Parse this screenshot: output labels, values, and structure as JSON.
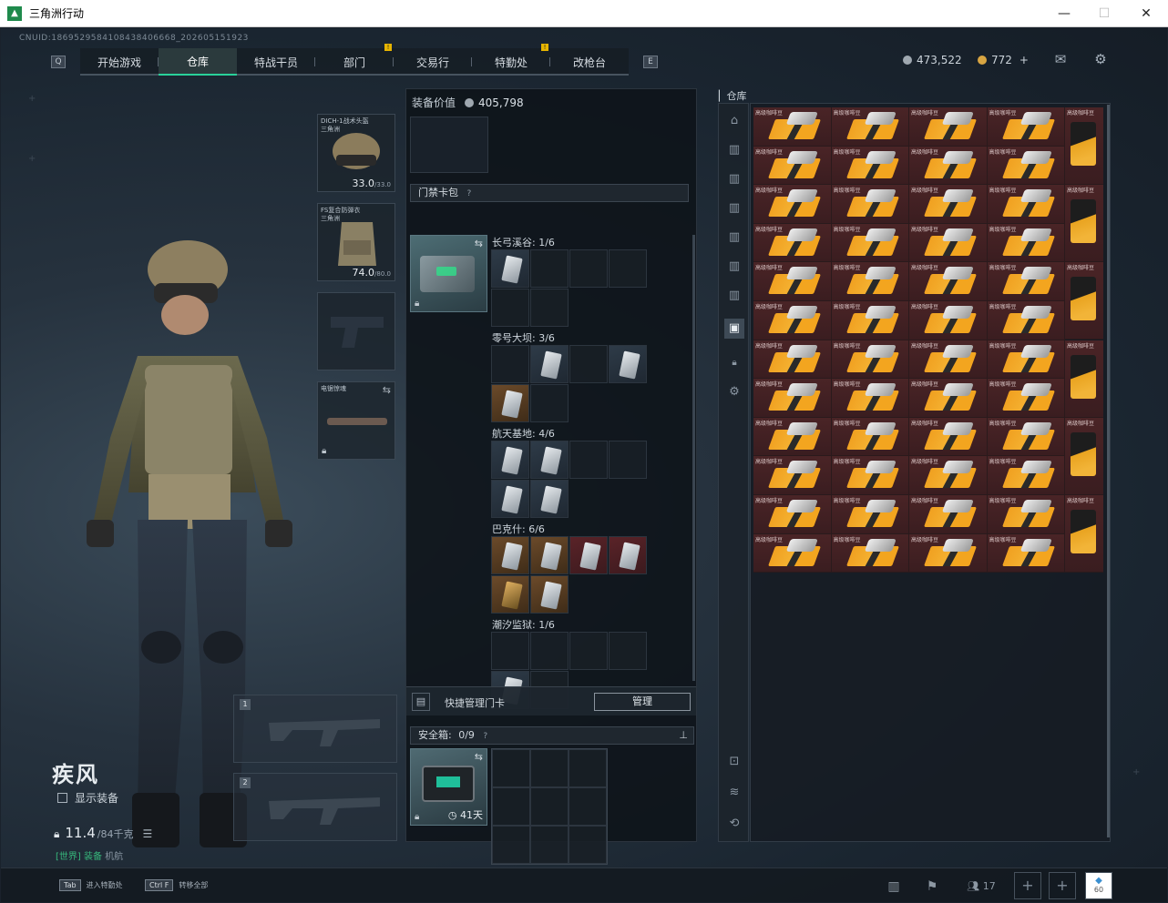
{
  "window": {
    "title": "三角洲行动"
  },
  "uid": "CNUID:1869529584108438406668_202605151923",
  "nav": {
    "tabs": [
      "开始游戏",
      "仓库",
      "特战干员",
      "部门",
      "交易行",
      "特勤处",
      "改枪台"
    ],
    "active": "仓库"
  },
  "currency": {
    "primary": "473,522",
    "secondary": "772",
    "add": "+"
  },
  "operator": {
    "name": "疾风",
    "show_equipment": "显示装备",
    "weight": "11.4",
    "weight_max": "/84千克",
    "status_a": "[世界] 装备",
    "status_b": "机航"
  },
  "equipment": {
    "helmet_label": "DICH-1战术头盔\n三角洲",
    "helmet_dur": "33.0",
    "helmet_max": "/33.0",
    "armor_label": "FS复合防弹衣\n三角洲",
    "armor_dur": "74.0",
    "armor_max": "/80.0",
    "melee_label": "电锯惊魂",
    "weapon_slot_1": "1",
    "weapon_slot_2": "2"
  },
  "middle": {
    "equip_value_label": "装备价值",
    "equip_value": "405,798",
    "keycard_bag": "门禁卡包",
    "maps": [
      {
        "label": "长弓溪谷: 1/6"
      },
      {
        "label": "零号大坝: 3/6"
      },
      {
        "label": "航天基地: 4/6"
      },
      {
        "label": "巴克什: 6/6"
      },
      {
        "label": "潮汐监狱: 1/6"
      }
    ],
    "quick_manage": "快捷管理门卡",
    "manage_btn": "管理",
    "safe_box": "安全箱:",
    "safe_count": "0/9",
    "safe_days": "41天"
  },
  "warehouse": {
    "label": "仓库",
    "item_name": "高级咖啡豆"
  },
  "bottom": {
    "hint1_key": "Tab",
    "hint1": "进入特勤处",
    "hint2_key": "Ctrl F",
    "hint2": "转移全部",
    "friends": "17",
    "badge": "60"
  },
  "colors": {
    "accent": "#29d19a",
    "item_bg": "#4a2426",
    "coffee_orange": "#f2b438"
  }
}
